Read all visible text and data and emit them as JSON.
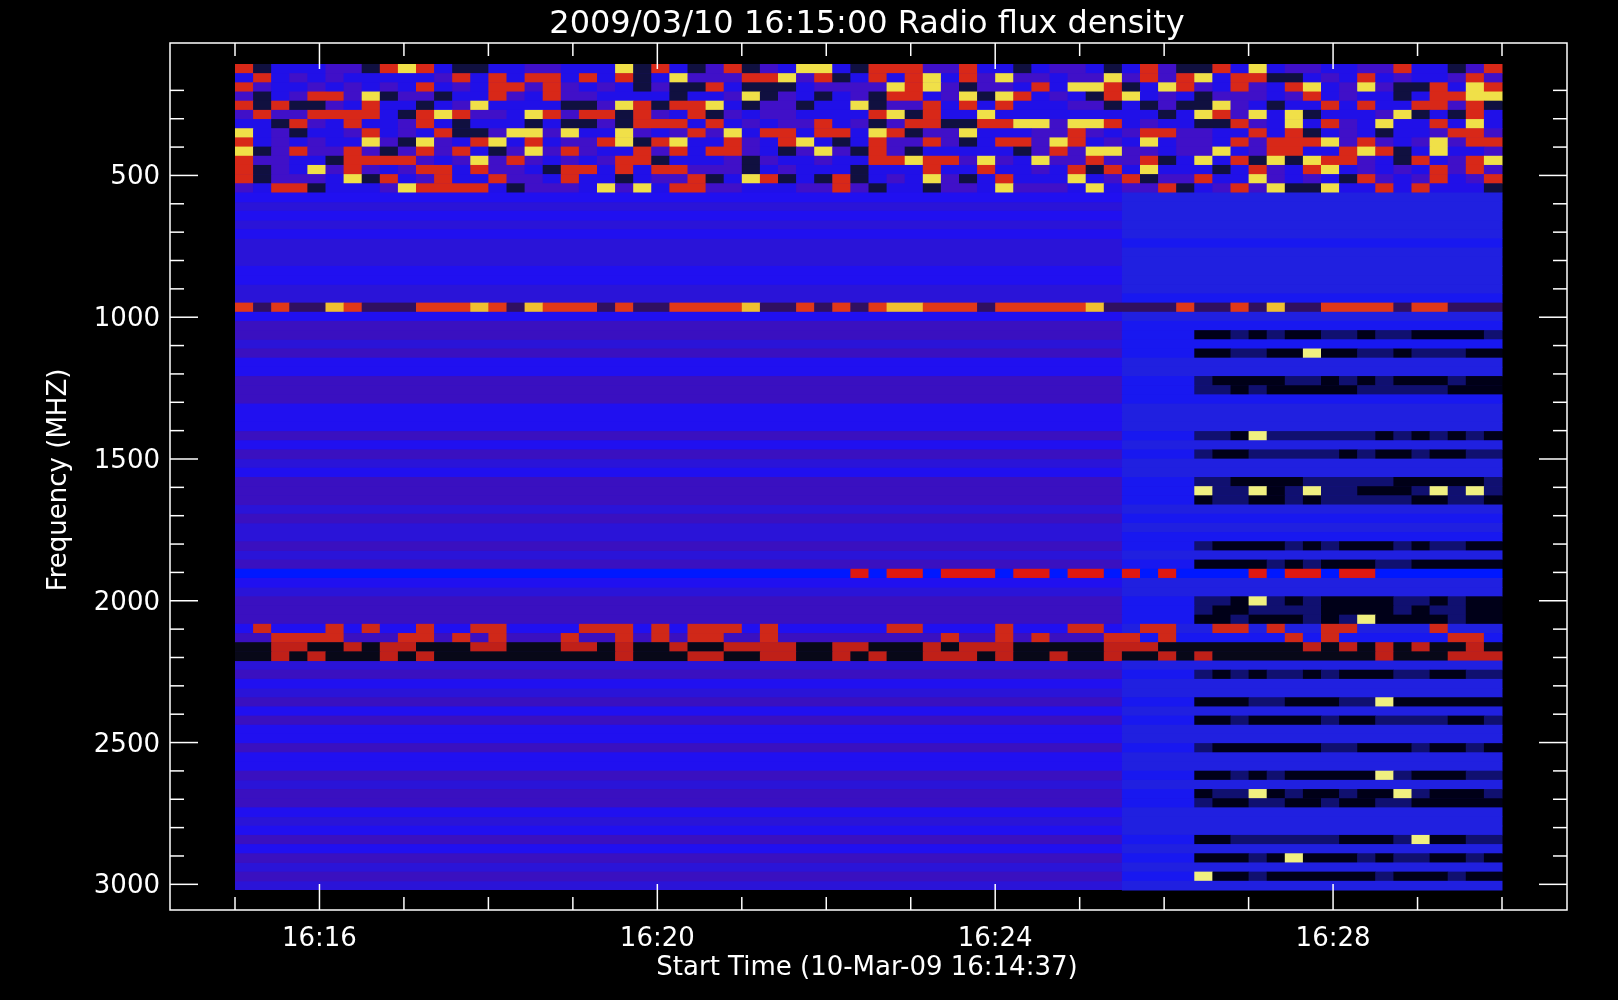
{
  "plot": {
    "title": "2009/03/10 16:15:00 Radio flux density",
    "ylabel": "Frequency (MHZ)",
    "xlabel": "Start Time (10-Mar-09 16:14:37)",
    "yticks": [
      "500",
      "1000",
      "1500",
      "2000",
      "2500",
      "3000"
    ],
    "xticks": [
      "16:16",
      "16:20",
      "16:24",
      "16:28"
    ]
  }
}
